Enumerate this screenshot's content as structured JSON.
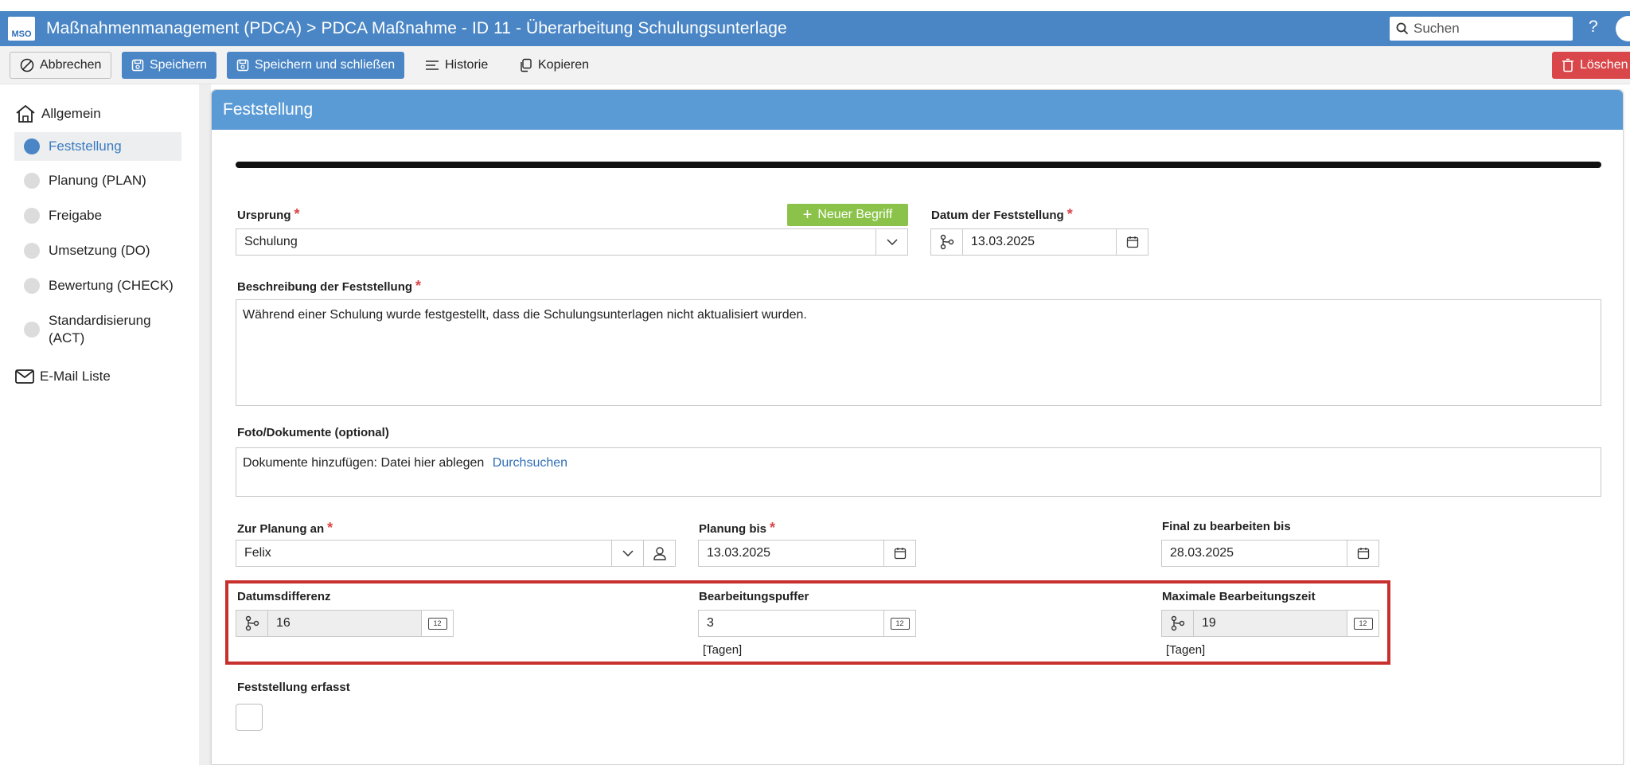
{
  "titlebar": {
    "logo": "MSO",
    "title": "Maßnahmenmanagement (PDCA) > PDCA Maßnahme - ID 11 - Überarbeitung Schulungsunterlage",
    "search_placeholder": "Suchen",
    "help": "?"
  },
  "toolbar": {
    "cancel": "Abbrechen",
    "save": "Speichern",
    "save_close": "Speichern und schließen",
    "history": "Historie",
    "copy": "Kopieren",
    "delete": "Löschen"
  },
  "sidebar": {
    "items": [
      {
        "label": "Allgemein"
      },
      {
        "label": "Feststellung"
      },
      {
        "label": "Planung (PLAN)"
      },
      {
        "label": "Freigabe"
      },
      {
        "label": "Umsetzung (DO)"
      },
      {
        "label": "Bewertung (CHECK)"
      },
      {
        "label": "Standardisierung (ACT)"
      },
      {
        "label": "E-Mail Liste"
      }
    ]
  },
  "panel": {
    "title": "Feststellung",
    "required_mark": "*",
    "ursprung": {
      "label": "Ursprung",
      "value": "Schulung"
    },
    "new_term_button": "Neuer Begriff",
    "datum": {
      "label": "Datum der Feststellung",
      "value": "13.03.2025"
    },
    "beschreibung": {
      "label": "Beschreibung der Feststellung",
      "value": "Während einer Schulung wurde festgestellt, dass die Schulungsunterlagen nicht aktualisiert wurden."
    },
    "foto": {
      "label": "Foto/Dokumente (optional)",
      "drop_text": "Dokumente hinzufügen: Datei hier ablegen",
      "browse": "Durchsuchen"
    },
    "zur_planung": {
      "label": "Zur Planung an",
      "value": "Felix"
    },
    "planung_bis": {
      "label": "Planung bis",
      "value": "13.03.2025"
    },
    "final_bis": {
      "label": "Final zu bearbeiten bis",
      "value": "28.03.2025"
    },
    "datumsdifferenz": {
      "label": "Datumsdifferenz",
      "value": "16"
    },
    "puffer": {
      "label": "Bearbeitungspuffer",
      "value": "3",
      "unit": "[Tagen]"
    },
    "max_zeit": {
      "label": "Maximale Bearbeitungszeit",
      "value": "19",
      "unit": "[Tagen]"
    },
    "erfasst": {
      "label": "Feststellung erfasst",
      "checked": false
    },
    "num_badge": "12"
  },
  "colors": {
    "header_blue": "#4a86c5",
    "panel_header": "#5a9bd6",
    "green": "#8bc34a",
    "danger": "#d9474a",
    "highlight_red": "#c8302e"
  }
}
